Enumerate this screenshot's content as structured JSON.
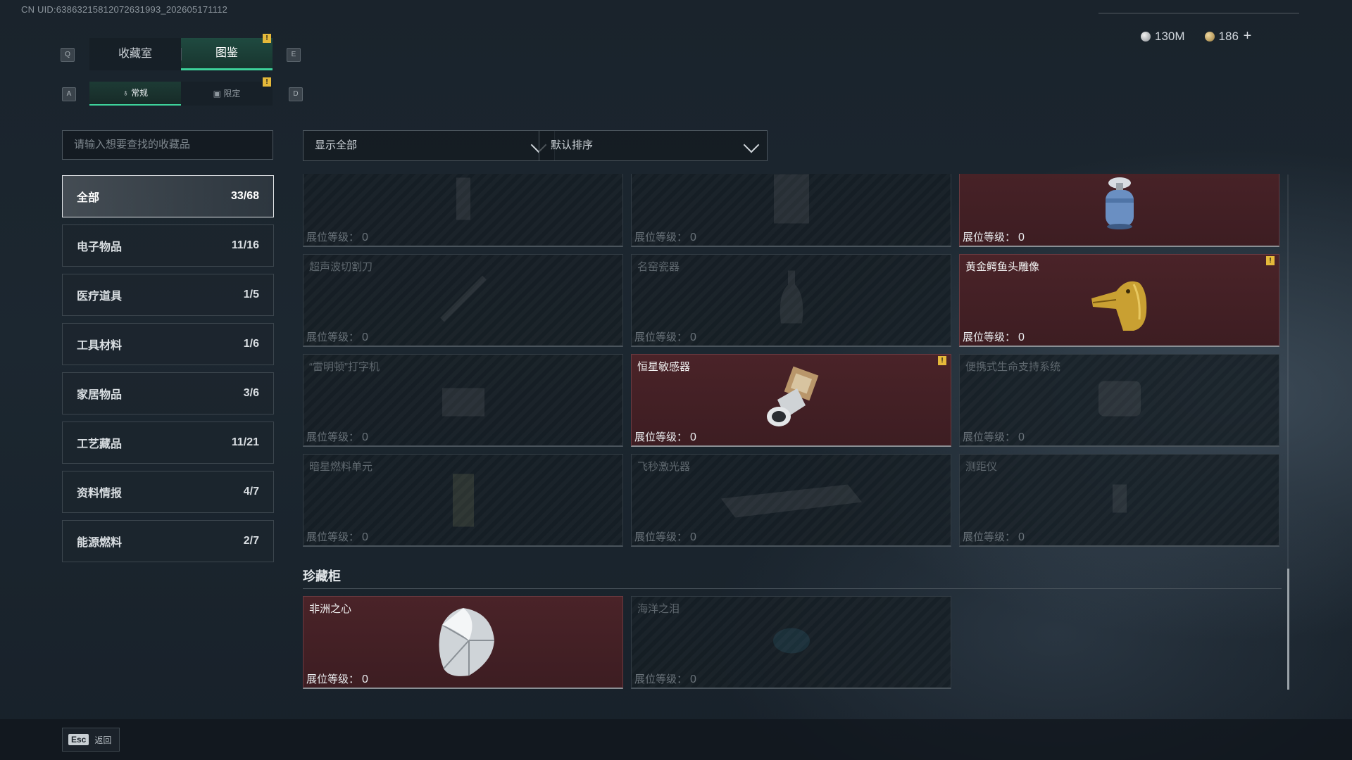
{
  "header": {
    "uid": "CN UID:6386321581207263​1993_202605171112",
    "currency": {
      "silver": "130M",
      "gold": "186",
      "plus": "+"
    }
  },
  "keys": {
    "prev_tab": "Q",
    "next_tab": "E",
    "prev_sub": "A",
    "next_sub": "D"
  },
  "tabs": [
    {
      "label": "收藏室"
    },
    {
      "label": "图鉴",
      "active": true
    }
  ],
  "subtabs": [
    {
      "label": "常规",
      "active": true
    },
    {
      "label": "限定"
    }
  ],
  "search": {
    "placeholder": "请输入想要查找的收藏品"
  },
  "categories": [
    {
      "label": "全部",
      "count": "33/68",
      "active": true
    },
    {
      "label": "电子物品",
      "count": "11/16"
    },
    {
      "label": "医疗道具",
      "count": "1/5"
    },
    {
      "label": "工具材料",
      "count": "1/6"
    },
    {
      "label": "家居物品",
      "count": "3/6"
    },
    {
      "label": "工艺藏品",
      "count": "11/21"
    },
    {
      "label": "资料情报",
      "count": "4/7"
    },
    {
      "label": "能源燃料",
      "count": "2/7"
    }
  ],
  "filters": {
    "show": "显示全部",
    "sort": "默认排序"
  },
  "level_label": "展位等级：",
  "items": [
    {
      "name": "",
      "level": "0",
      "owned": false,
      "icon": "bottle-icon"
    },
    {
      "name": "",
      "level": "0",
      "owned": false,
      "icon": "machine-icon"
    },
    {
      "name": "",
      "level": "0",
      "owned": true,
      "icon": "gas-canister-icon"
    },
    {
      "name": "超声波切割刀",
      "level": "0",
      "owned": false,
      "icon": "knife-icon"
    },
    {
      "name": "名窑瓷器",
      "level": "0",
      "owned": false,
      "icon": "vase-icon"
    },
    {
      "name": "黄金鳄鱼头雕像",
      "level": "0",
      "owned": true,
      "icon": "gold-crocodile-icon",
      "warn": true
    },
    {
      "name": "“雷明顿”打字机",
      "level": "0",
      "owned": false,
      "icon": "typewriter-icon"
    },
    {
      "name": "恒星敏感器",
      "level": "0",
      "owned": true,
      "icon": "star-sensor-icon",
      "warn": true
    },
    {
      "name": "便携式生命支持系统",
      "level": "0",
      "owned": false,
      "icon": "life-support-icon"
    },
    {
      "name": "暗星燃料单元",
      "level": "0",
      "owned": false,
      "icon": "fuel-cell-icon"
    },
    {
      "name": "飞秒激光器",
      "level": "0",
      "owned": false,
      "icon": "laser-icon"
    },
    {
      "name": "测距仪",
      "level": "0",
      "owned": false,
      "icon": "rangefinder-icon"
    }
  ],
  "section": {
    "title": "珍藏柜"
  },
  "treasures": [
    {
      "name": "非洲之心",
      "level": "0",
      "owned": true,
      "icon": "diamond-icon"
    },
    {
      "name": "海洋之泪",
      "level": "0",
      "owned": false,
      "icon": "gem-icon"
    }
  ],
  "footer": {
    "esc_key": "Esc",
    "esc_label": "返回"
  }
}
